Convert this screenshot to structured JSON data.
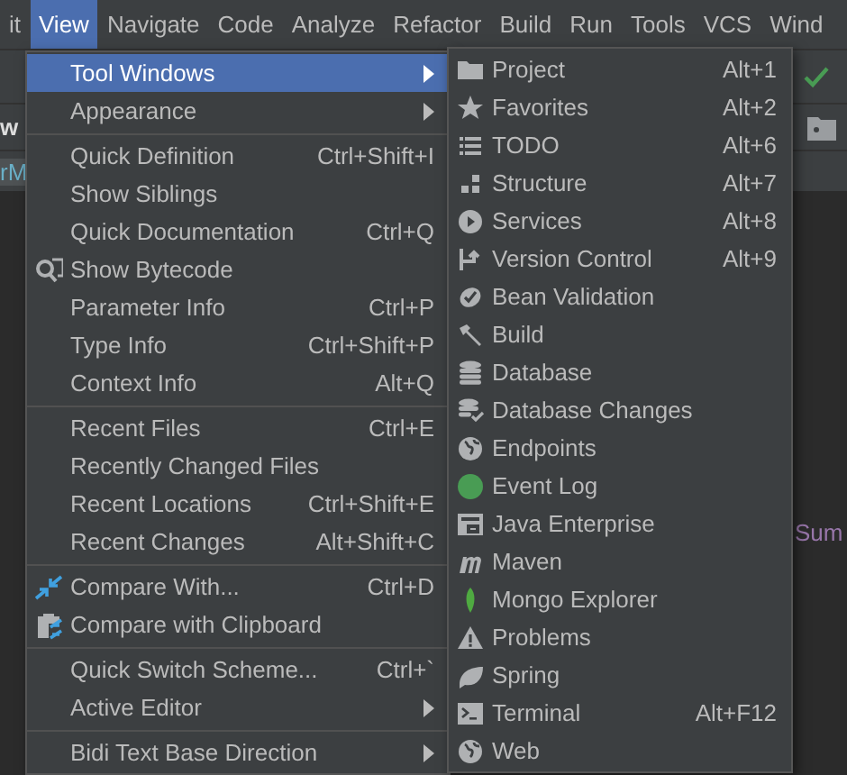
{
  "menubar": {
    "items": [
      {
        "label": "it",
        "selected": false
      },
      {
        "label": "View",
        "selected": true
      },
      {
        "label": "Navigate",
        "selected": false
      },
      {
        "label": "Code",
        "selected": false
      },
      {
        "label": "Analyze",
        "selected": false
      },
      {
        "label": "Refactor",
        "selected": false
      },
      {
        "label": "Build",
        "selected": false
      },
      {
        "label": "Run",
        "selected": false
      },
      {
        "label": "Tools",
        "selected": false
      },
      {
        "label": "VCS",
        "selected": false
      },
      {
        "label": "Wind",
        "selected": false
      }
    ]
  },
  "background": {
    "tab_text": "w",
    "breadcrumb_text": "rM",
    "code_text": "Sum"
  },
  "view_menu": {
    "items": [
      {
        "kind": "submenu",
        "label": "Tool Windows",
        "selected": true
      },
      {
        "kind": "submenu",
        "label": "Appearance",
        "selected": false
      },
      {
        "kind": "separator"
      },
      {
        "kind": "item",
        "label": "Quick Definition",
        "shortcut": "Ctrl+Shift+I",
        "selected": false
      },
      {
        "kind": "item",
        "label": "Show Siblings",
        "selected": false
      },
      {
        "kind": "item",
        "label": "Quick Documentation",
        "shortcut": "Ctrl+Q",
        "selected": false
      },
      {
        "kind": "item",
        "label": "Show Bytecode",
        "selected": false
      },
      {
        "kind": "item",
        "label": "Parameter Info",
        "shortcut": "Ctrl+P",
        "selected": false
      },
      {
        "kind": "item",
        "label": "Type Info",
        "shortcut": "Ctrl+Shift+P",
        "selected": false
      },
      {
        "kind": "item",
        "label": "Context Info",
        "shortcut": "Alt+Q",
        "selected": false
      },
      {
        "kind": "separator"
      },
      {
        "kind": "item",
        "label": "Recent Files",
        "shortcut": "Ctrl+E",
        "selected": false
      },
      {
        "kind": "item",
        "label": "Recently Changed Files",
        "selected": false
      },
      {
        "kind": "item",
        "label": "Recent Locations",
        "shortcut": "Ctrl+Shift+E",
        "selected": false
      },
      {
        "kind": "item",
        "label": "Recent Changes",
        "shortcut": "Alt+Shift+C",
        "selected": false
      },
      {
        "kind": "separator"
      },
      {
        "kind": "item",
        "label": "Compare With...",
        "shortcut": "Ctrl+D",
        "selected": false
      },
      {
        "kind": "item",
        "label": "Compare with Clipboard",
        "selected": false
      },
      {
        "kind": "separator"
      },
      {
        "kind": "item",
        "label": "Quick Switch Scheme...",
        "shortcut": "Ctrl+`",
        "selected": false
      },
      {
        "kind": "submenu",
        "label": "Active Editor",
        "selected": false
      },
      {
        "kind": "separator"
      },
      {
        "kind": "submenu",
        "label": "Bidi Text Base Direction",
        "selected": false
      }
    ]
  },
  "tool_windows_menu": {
    "items": [
      {
        "kind": "item",
        "label": "Project",
        "shortcut": "Alt+1",
        "selected": false
      },
      {
        "kind": "item",
        "label": "Favorites",
        "shortcut": "Alt+2",
        "selected": false
      },
      {
        "kind": "item",
        "label": "TODO",
        "shortcut": "Alt+6",
        "selected": false
      },
      {
        "kind": "item",
        "label": "Structure",
        "shortcut": "Alt+7",
        "selected": false
      },
      {
        "kind": "item",
        "label": "Services",
        "shortcut": "Alt+8",
        "selected": false
      },
      {
        "kind": "item",
        "label": "Version Control",
        "shortcut": "Alt+9",
        "selected": false
      },
      {
        "kind": "item",
        "label": "Bean Validation",
        "selected": false
      },
      {
        "kind": "item",
        "label": "Build",
        "selected": false
      },
      {
        "kind": "item",
        "label": "Database",
        "selected": false
      },
      {
        "kind": "item",
        "label": "Database Changes",
        "selected": false
      },
      {
        "kind": "item",
        "label": "Endpoints",
        "selected": false
      },
      {
        "kind": "item",
        "label": "Event Log",
        "selected": false
      },
      {
        "kind": "item",
        "label": "Java Enterprise",
        "selected": false
      },
      {
        "kind": "item",
        "label": "Maven",
        "selected": false
      },
      {
        "kind": "item",
        "label": "Mongo Explorer",
        "selected": false
      },
      {
        "kind": "item",
        "label": "Problems",
        "selected": false
      },
      {
        "kind": "item",
        "label": "Spring",
        "selected": false
      },
      {
        "kind": "item",
        "label": "Terminal",
        "shortcut": "Alt+F12",
        "selected": false
      },
      {
        "kind": "item",
        "label": "Web",
        "selected": false
      }
    ]
  }
}
